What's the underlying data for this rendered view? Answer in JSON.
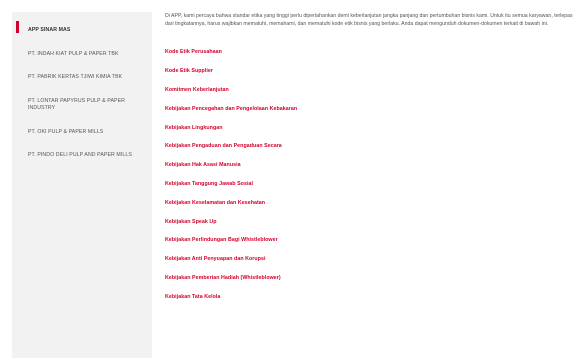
{
  "sidebar": {
    "items": [
      {
        "label": "APP SINAR MAS"
      },
      {
        "label": "PT. INDAH KIAT PULP & PAPER TBK"
      },
      {
        "label": "PT. PABRIK KERTAS TJIWI KIMIA TBK"
      },
      {
        "label": "PT. LONTAR PAPYRUS PULP & PAPER INDUSTRY"
      },
      {
        "label": "PT. OKI PULP & PAPER MILLS"
      },
      {
        "label": "PT. PINDO DELI PULP AND PAPER MILLS"
      }
    ]
  },
  "main": {
    "intro": "Di APP, kami percaya bahwa standar etika yang tinggi perlu dipertahankan demi keberlanjutan jangka panjang dan pertumbuhan bisnis kami. Untuk itu semua karyawan, terlepas dari tingkatannya, harus wajibkan mematuhi, memahami, dan mematuhi kode etik bisnis yang berlaku. Anda dapat mengunduh dokumen-dokumen terkait di bawah ini.",
    "links": [
      "Kode Etik Perusahaan",
      "Kode Etik Supplier",
      "Komitmen Keberlanjutan",
      "Kebijakan Pencegahan dan Pengelolaan Kebakaran",
      "Kebijakan Lingkungan",
      "Kebijakan Pengaduan dan Pengaduan Secara",
      "Kebijakan Hak Asasi Manusia",
      "Kebijakan Tanggung Jawab Sosial",
      "Kebijakan Keselamatan dan Kesehatan",
      "Kebijakan Speak Up",
      "Kebijakan Perlindungan Bagi Whistleblower",
      "Kebijakan Anti Penyuapan dan Korupsi",
      "Kebijakan Pemberian Hadiah (Whistleblower)",
      "Kebijakan Tata Kelola"
    ]
  },
  "colors": {
    "accent": "#d3002b",
    "sidebar_bg": "#f2f2f2"
  }
}
